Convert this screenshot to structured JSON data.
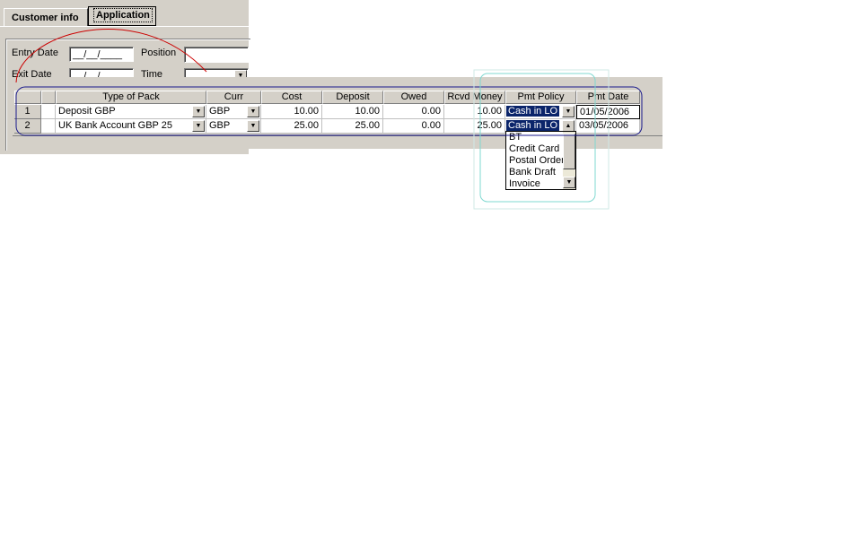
{
  "tabs": {
    "customer_info": "Customer info",
    "application": "Application"
  },
  "form": {
    "entry_date_label": "Entry Date",
    "exit_date_label": "Exit Date",
    "position_label": "Position",
    "time_label": "Time",
    "entry_date_value": "__/__/____",
    "exit_date_value": "__/__/____"
  },
  "grid": {
    "columns": [
      "",
      "",
      "Type of Pack",
      "Curr",
      "Cost",
      "Deposit",
      "Owed",
      "Rcvd Money",
      "Pmt Policy",
      "Pmt Date"
    ],
    "rows": [
      {
        "num": "1",
        "type": "Deposit GBP",
        "curr": "GBP",
        "cost": "10.00",
        "deposit": "10.00",
        "owed": "0.00",
        "rcvd": "10.00",
        "policy": "Cash in LO",
        "date": "01/05/2006"
      },
      {
        "num": "2",
        "type": "UK Bank Account GBP 25",
        "curr": "GBP",
        "cost": "25.00",
        "deposit": "25.00",
        "owed": "0.00",
        "rcvd": "25.00",
        "policy": "Cash in LO",
        "date": "03/05/2006"
      }
    ]
  },
  "policy_dropdown": {
    "options": [
      "BT",
      "Credit Card",
      "Postal Order",
      "Bank Draft",
      "Invoice"
    ]
  },
  "colors": {
    "panel": "#d4d0c8",
    "selection": "#0a246a",
    "annotation_red": "#cc0000",
    "annotation_blue": "#1a1a8c",
    "annotation_cyan": "#7fd8d0"
  }
}
